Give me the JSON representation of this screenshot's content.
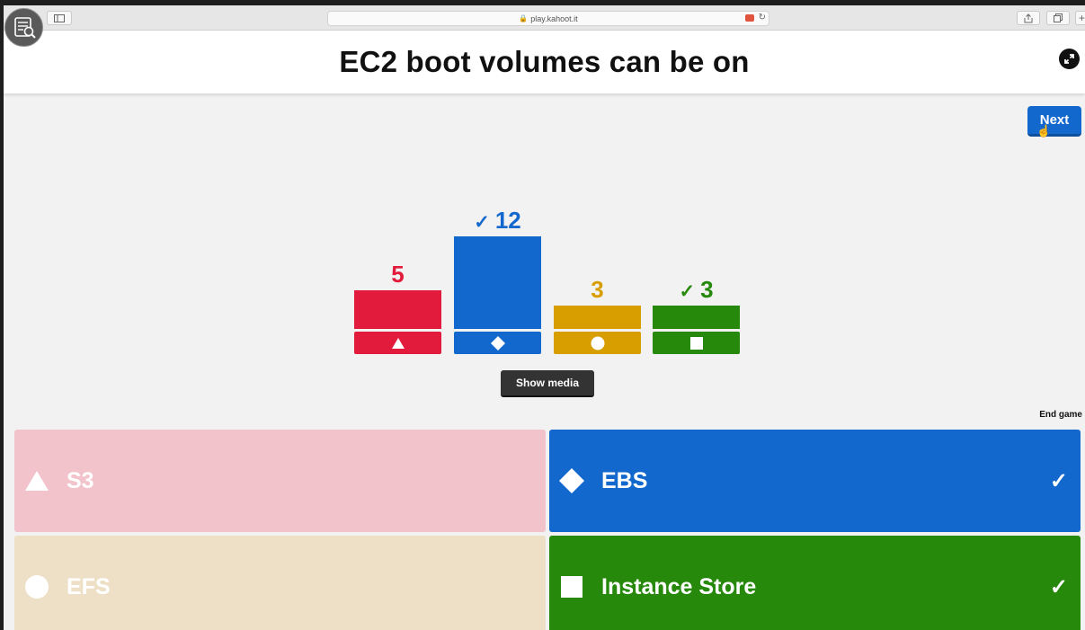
{
  "browser": {
    "url": "play.kahoot.it",
    "lock_icon": "lock-icon",
    "reload_icon": "reload-icon"
  },
  "question": {
    "title": "EC2 boot volumes can be on"
  },
  "controls": {
    "next_label": "Next",
    "show_media_label": "Show media",
    "end_game_label": "End game"
  },
  "colors": {
    "red": "#e21b3c",
    "blue": "#1368ce",
    "yellow": "#d89e00",
    "green": "#26890c",
    "red_faded": "#f2c3ca",
    "yellow_faded": "#ede0c6"
  },
  "chart_data": {
    "type": "bar",
    "categories": [
      "triangle",
      "diamond",
      "circle",
      "square"
    ],
    "values": [
      5,
      12,
      3,
      3
    ],
    "correct": [
      false,
      true,
      false,
      true
    ],
    "count_labels": [
      "5",
      "12",
      "3",
      "3"
    ]
  },
  "answers": [
    {
      "shape": "triangle",
      "label": "S3",
      "correct": false
    },
    {
      "shape": "diamond",
      "label": "EBS",
      "correct": true
    },
    {
      "shape": "circle",
      "label": "EFS",
      "correct": false
    },
    {
      "shape": "square",
      "label": "Instance Store",
      "correct": true
    }
  ],
  "check_mark": "✓"
}
